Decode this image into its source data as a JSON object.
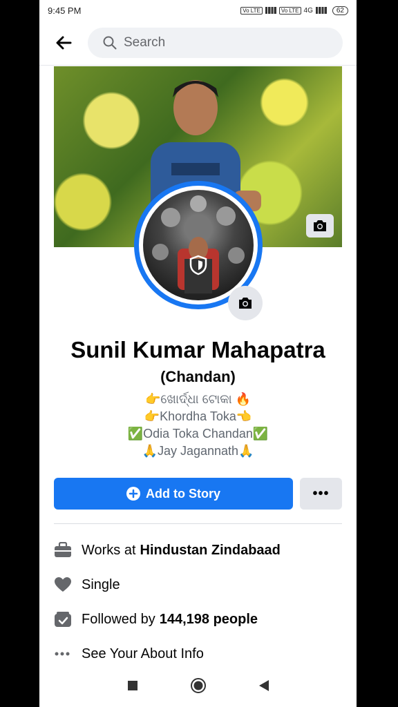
{
  "status": {
    "time": "9:45 PM",
    "volte1": "Vo LTE",
    "volte2": "Vo LTE",
    "net2": "4G",
    "battery": "62"
  },
  "header": {
    "search_placeholder": "Search"
  },
  "profile": {
    "name": "Sunil Kumar Mahapatra",
    "nickname": "(Chandan)",
    "bio": [
      "👉ଖୋର୍ଦ୍ଧା ଟୋକା 🔥",
      "👉Khordha Toka👈",
      "✅Odia Toka Chandan✅",
      "🙏Jay Jagannath🙏"
    ]
  },
  "actions": {
    "add_story": "Add to Story",
    "more": "•••"
  },
  "info": {
    "work_prefix": "Works at",
    "work_place": "Hindustan Zindabaad",
    "relationship": "Single",
    "followed_prefix": "Followed by",
    "followers": "144,198 people",
    "about": "See Your About Info"
  },
  "colors": {
    "accent": "#1877f2",
    "icon_gray": "#65676b",
    "button_gray": "#e4e6eb"
  }
}
